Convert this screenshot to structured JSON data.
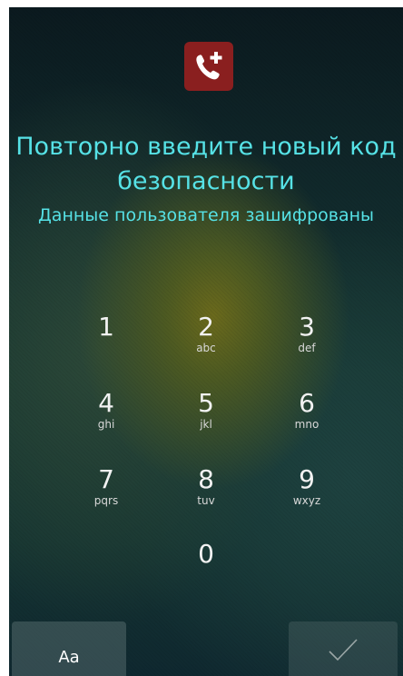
{
  "header": {
    "title_line1": "Повторно введите новый код",
    "title_line2": "безопасности",
    "subtitle": "Данные пользователя зашифрованы",
    "icon": "emergency-call-icon",
    "icon_color": "#8a1f1f",
    "title_color": "#56e2e6"
  },
  "keypad": {
    "keys": [
      {
        "digit": "1",
        "letters": ""
      },
      {
        "digit": "2",
        "letters": "abc"
      },
      {
        "digit": "3",
        "letters": "def"
      },
      {
        "digit": "4",
        "letters": "ghi"
      },
      {
        "digit": "5",
        "letters": "jkl"
      },
      {
        "digit": "6",
        "letters": "mno"
      },
      {
        "digit": "7",
        "letters": "pqrs"
      },
      {
        "digit": "8",
        "letters": "tuv"
      },
      {
        "digit": "9",
        "letters": "wxyz"
      },
      {
        "digit": "0",
        "letters": ""
      }
    ]
  },
  "bottom": {
    "keyboard_switch_label": "Aa",
    "confirm_icon": "checkmark-icon"
  }
}
